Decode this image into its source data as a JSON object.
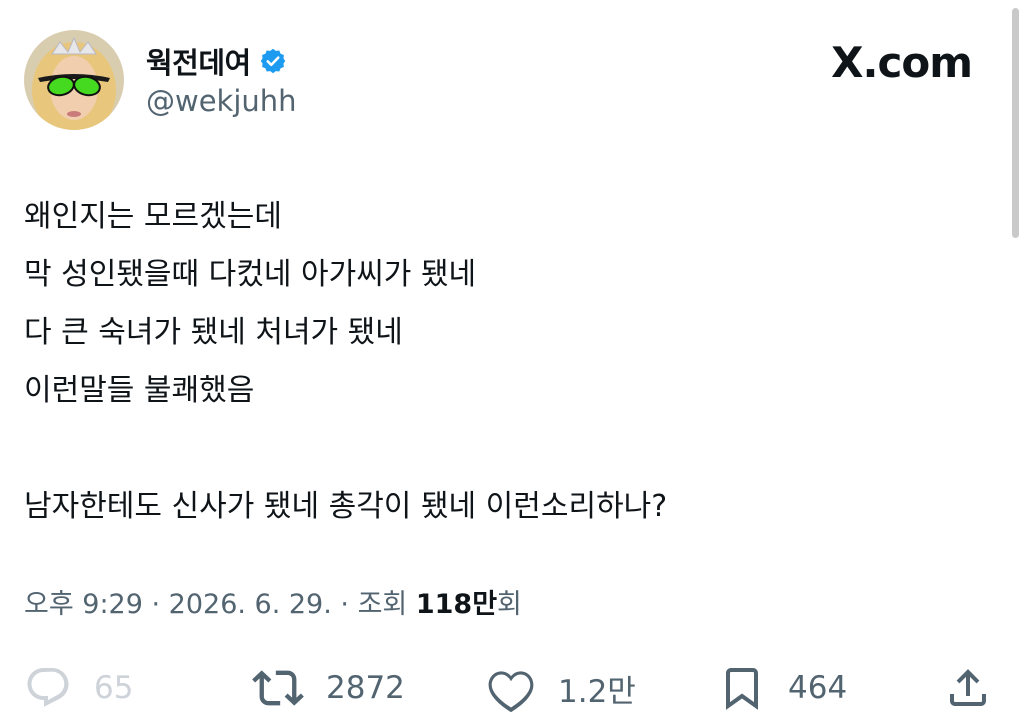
{
  "user": {
    "display_name": "웍전데여",
    "handle": "@wekjuhh"
  },
  "brand": "X.com",
  "tweet": {
    "lines": [
      "왜인지는 모르겠는데",
      "막 성인됐을때 다컸네 아가씨가 됐네",
      "다 큰 숙녀가 됐네 처녀가 됐네",
      "이런말들 불쾌했음",
      "",
      "남자한테도 신사가 됐네 총각이 됐네 이런소리하나?"
    ]
  },
  "meta": {
    "time": "오후 9:29",
    "sep1": " · ",
    "date": "2026. 6. 29.",
    "sep2": " · ",
    "views_label": "조회 ",
    "views_count": "118만",
    "views_suffix": "회"
  },
  "actions": {
    "replies": "65",
    "reposts": "2872",
    "likes": "1.2만",
    "bookmarks": "464"
  },
  "icons": {
    "verified": "verified-badge-icon",
    "reply": "reply-icon",
    "repost": "repost-icon",
    "like": "heart-icon",
    "bookmark": "bookmark-icon",
    "share": "share-icon"
  },
  "colors": {
    "verified": "#1d9bf0",
    "secondary_text": "#536471",
    "primary_text": "#0f1419"
  }
}
